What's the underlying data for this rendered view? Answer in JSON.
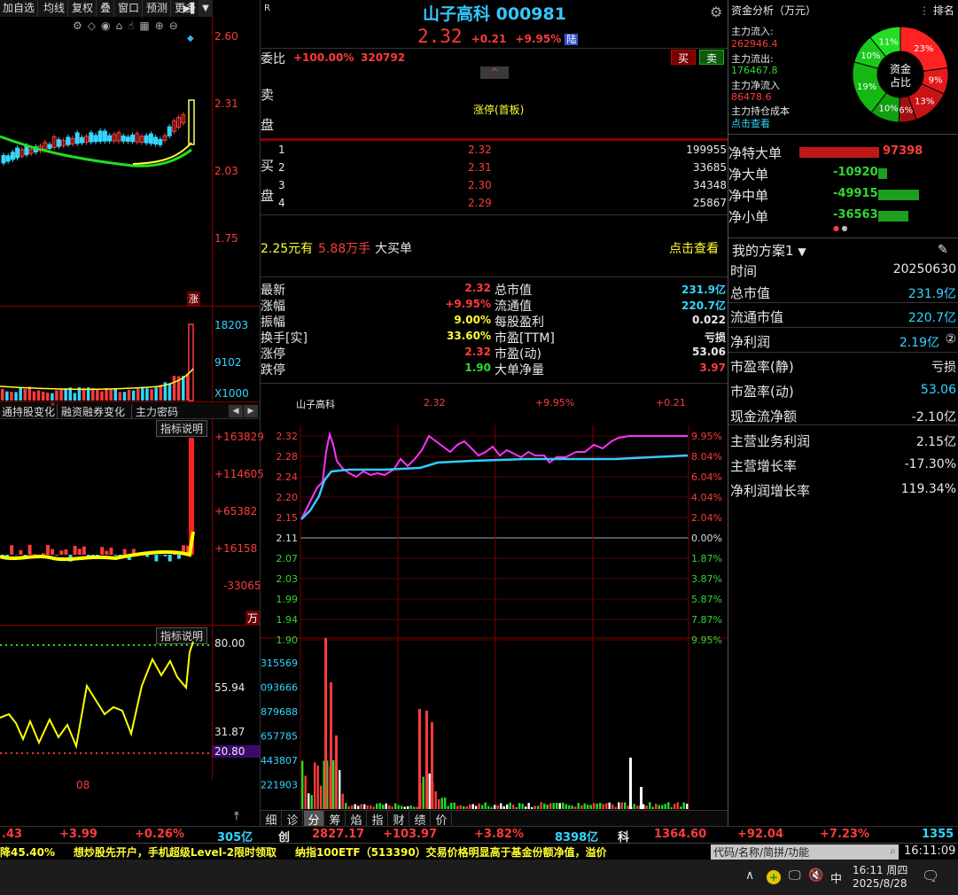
{
  "toolbar": {
    "buttons": [
      "加自选",
      "均线",
      "复权",
      "叠",
      "窗口",
      "预测",
      "更多"
    ],
    "kline_prices": [
      "2.60",
      "2.31",
      "2.03",
      "1.75"
    ],
    "zhang": "涨",
    "vol_labels": [
      "18203",
      "9102",
      "X1000"
    ],
    "tabs": [
      "通持股变化",
      "融资融券变化",
      "主力密码"
    ],
    "indicator_btn": "指标说明",
    "ind1_labels": [
      "+163829",
      "+114605",
      "+65382",
      "+16158",
      "-33065"
    ],
    "ind1_unit": "万",
    "ind2_labels": [
      "80.00",
      "55.94",
      "31.87",
      "20.80"
    ],
    "x_label": "08"
  },
  "quote": {
    "r_tag": "R",
    "title": "山子高科 000981",
    "price": "2.32",
    "change": "+0.21",
    "pct": "+9.95%",
    "market": "陆",
    "weibi_label": "委比",
    "weibi_pct": "+100.00%",
    "weibi_val": "320792",
    "sell_btn": "买",
    "buy_btn": "卖",
    "sell_side_label": "卖盘",
    "limit_text": "涨停(首板)",
    "buy_side_label": "买盘",
    "bids": [
      {
        "n": "1",
        "price": "2.32",
        "vol": "199955"
      },
      {
        "n": "2",
        "price": "2.31",
        "vol": "33685"
      },
      {
        "n": "3",
        "price": "2.30",
        "vol": "34348"
      },
      {
        "n": "4",
        "price": "2.29",
        "vol": "25867"
      }
    ],
    "big_order_price": "2.25元有",
    "big_order_vol": "5.88万手",
    "big_order_text": "大买单",
    "big_order_link": "点击查看",
    "stats_left": [
      {
        "k": "最新",
        "v": "2.32",
        "c": "red"
      },
      {
        "k": "涨幅",
        "v": "+9.95%",
        "c": "red"
      },
      {
        "k": "振幅",
        "v": "9.00%",
        "c": "yellow"
      },
      {
        "k": "换手[实]",
        "v": "33.60%",
        "c": "yellow"
      },
      {
        "k": "涨停",
        "v": "2.32",
        "c": "red"
      },
      {
        "k": "跌停",
        "v": "1.90",
        "c": "green"
      }
    ],
    "stats_right": [
      {
        "k": "总市值",
        "v": "231.9亿",
        "c": "cyan"
      },
      {
        "k": "流通值",
        "v": "220.7亿",
        "c": "cyan"
      },
      {
        "k": "每股盈利",
        "v": "0.022",
        "c": "white"
      },
      {
        "k": "市盈[TTM]",
        "v": "亏损",
        "c": "white"
      },
      {
        "k": "市盈(动)",
        "v": "53.06",
        "c": "white"
      },
      {
        "k": "大单净量",
        "v": "3.97",
        "c": "red"
      }
    ]
  },
  "intraday": {
    "header_name": "山子高科",
    "header_price": "2.32",
    "header_pct": "+9.95%",
    "header_chg": "+0.21",
    "prices": [
      "2.32",
      "2.28",
      "2.24",
      "2.20",
      "2.15",
      "2.11",
      "2.07",
      "2.03",
      "1.99",
      "1.94",
      "1.90"
    ],
    "pcts": [
      "9.95%",
      "8.04%",
      "6.04%",
      "4.04%",
      "2.04%",
      "0.00%",
      "1.87%",
      "3.87%",
      "5.87%",
      "7.87%",
      "9.95%"
    ],
    "vol_labels": [
      "315569",
      "093666",
      "879688",
      "657785",
      "443807",
      "221903"
    ],
    "bottom_tabs": [
      "细",
      "诊",
      "分",
      "筹",
      "焰",
      "指",
      "财",
      "绩",
      "价"
    ]
  },
  "fund": {
    "title": "资金分析（万元）",
    "rank": "排名",
    "inflow_label": "主力流入:",
    "inflow": "262946.4",
    "outflow_label": "主力流出:",
    "outflow": "176467.8",
    "net_label": "主力净流入",
    "net": "86478.6",
    "cost_label": "主力持仓成本",
    "cost_link": "点击查看",
    "donut_center": "资金占比",
    "donut": [
      {
        "label": "23%",
        "value": 23,
        "color": "#ff2222"
      },
      {
        "label": "9%",
        "value": 9,
        "color": "#e41a1a"
      },
      {
        "label": "13%",
        "value": 13,
        "color": "#c81414"
      },
      {
        "label": "6%",
        "value": 6,
        "color": "#a01010"
      },
      {
        "label": "10%",
        "value": 10,
        "color": "#0f9f0f"
      },
      {
        "label": "19%",
        "value": 19,
        "color": "#13b813"
      },
      {
        "label": "10%",
        "value": 10,
        "color": "#19c919"
      },
      {
        "label": "11%",
        "value": 11,
        "color": "#22dd22"
      }
    ],
    "flows": [
      {
        "k": "净特大单",
        "v": "97398",
        "c": "red",
        "frac": 1.0
      },
      {
        "k": "净大单",
        "v": "-10920",
        "c": "green",
        "frac": 0.11
      },
      {
        "k": "净中单",
        "v": "-49915",
        "c": "green",
        "frac": 0.51
      },
      {
        "k": "净小单",
        "v": "-36563",
        "c": "green",
        "frac": 0.38
      }
    ]
  },
  "plan": {
    "title": "我的方案1",
    "rows": [
      {
        "k": "时间",
        "v": "20250630",
        "c": "white"
      },
      {
        "k": "总市值",
        "v": "231.9亿",
        "c": "cyan"
      },
      {
        "k": "流通市值",
        "v": "220.7亿",
        "c": "cyan"
      },
      {
        "k": "净利润",
        "v": "2.19亿",
        "c": "cyan",
        "extra": "②"
      },
      {
        "k": "市盈率(静)",
        "v": "亏损",
        "c": "white"
      },
      {
        "k": "市盈率(动)",
        "v": "53.06",
        "c": "cyan"
      },
      {
        "k": "现金流净额",
        "v": "-2.10亿",
        "c": "white"
      },
      {
        "k": "主营业务利润",
        "v": "2.15亿",
        "c": "white"
      },
      {
        "k": "主营增长率",
        "v": "-17.30%",
        "c": "white"
      },
      {
        "k": "净利润增长率",
        "v": "119.34%",
        "c": "white"
      }
    ]
  },
  "ticker": {
    "items": [
      {
        "t": ".43",
        "c": "red"
      },
      {
        "t": "+3.99",
        "c": "red"
      },
      {
        "t": "+0.26%",
        "c": "red"
      },
      {
        "t": "305亿",
        "c": "cyan"
      },
      {
        "t": "创",
        "c": "white"
      },
      {
        "t": "2827.17",
        "c": "red"
      },
      {
        "t": "+103.97",
        "c": "red"
      },
      {
        "t": "+3.82%",
        "c": "red"
      },
      {
        "t": "8398亿",
        "c": "cyan"
      },
      {
        "t": "科",
        "c": "white"
      },
      {
        "t": "1364.60",
        "c": "red"
      },
      {
        "t": "+92.04",
        "c": "red"
      },
      {
        "t": "+7.23%",
        "c": "red"
      },
      {
        "t": "1355亿",
        "c": "cyan"
      }
    ],
    "news": "降45.40%     想炒股先开户，手机超级Level-2限时领取     纳指100ETF（513390）交易价格明显高于基金份额净值，溢价",
    "search_placeholder": "代码/名称/简拼/功能",
    "clock": "16:11:09"
  },
  "taskbar": {
    "ime": "中",
    "time": "16:11 周四",
    "date": "2025/8/28"
  }
}
